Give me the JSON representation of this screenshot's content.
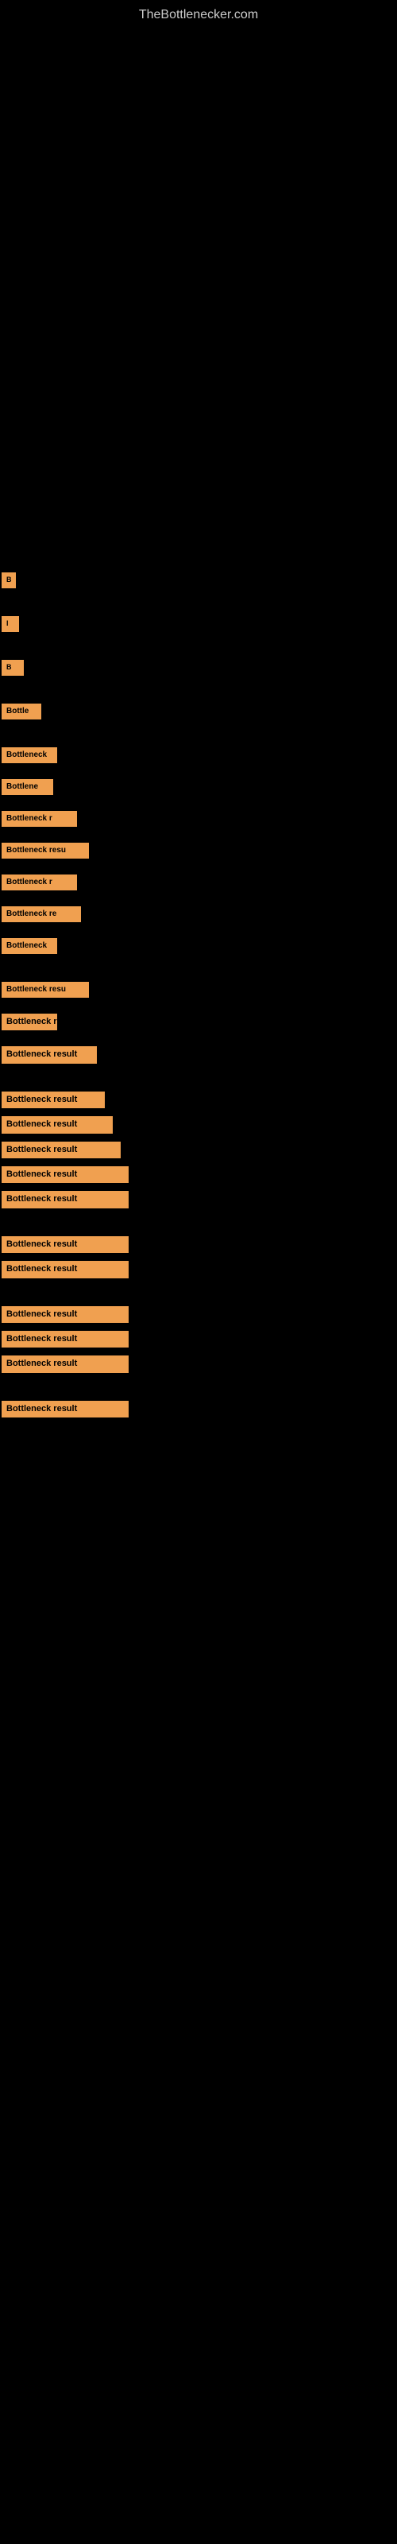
{
  "site": {
    "title": "TheBottlenecker.com"
  },
  "bottleneck_items": [
    {
      "id": 1,
      "label": "B",
      "size_class": "item-tiny",
      "spacing": "large"
    },
    {
      "id": 2,
      "label": "l",
      "size_class": "item-small1",
      "spacing": "large"
    },
    {
      "id": 3,
      "label": "B",
      "size_class": "item-small2",
      "spacing": "large"
    },
    {
      "id": 4,
      "label": "Bottle",
      "size_class": "item-med1",
      "spacing": "large"
    },
    {
      "id": 5,
      "label": "Bottleneck",
      "size_class": "item-med2",
      "spacing": "med"
    },
    {
      "id": 6,
      "label": "Bottlene",
      "size_class": "item-med3",
      "spacing": "med"
    },
    {
      "id": 7,
      "label": "Bottleneck r",
      "size_class": "item-med4",
      "spacing": "med"
    },
    {
      "id": 8,
      "label": "Bottleneck resu",
      "size_class": "item-med5",
      "spacing": "med"
    },
    {
      "id": 9,
      "label": "Bottleneck r",
      "size_class": "item-med4",
      "spacing": "med"
    },
    {
      "id": 10,
      "label": "Bottleneck re",
      "size_class": "item-med6",
      "spacing": "med"
    },
    {
      "id": 11,
      "label": "Bottleneck",
      "size_class": "item-med2",
      "spacing": "large"
    },
    {
      "id": 12,
      "label": "Bottleneck resu",
      "size_class": "item-med5",
      "spacing": "med"
    },
    {
      "id": 13,
      "label": "Bottleneck re",
      "size_class": "item-large1",
      "spacing": "med"
    },
    {
      "id": 14,
      "label": "Bottleneck result",
      "size_class": "item-large2",
      "spacing": "large"
    },
    {
      "id": 15,
      "label": "Bottleneck result",
      "size_class": "item-large3",
      "spacing": "small"
    },
    {
      "id": 16,
      "label": "Bottleneck result",
      "size_class": "item-large4",
      "spacing": "small"
    },
    {
      "id": 17,
      "label": "Bottleneck result",
      "size_class": "item-large5",
      "spacing": "small"
    },
    {
      "id": 18,
      "label": "Bottleneck result",
      "size_class": "item-full",
      "spacing": "small"
    },
    {
      "id": 19,
      "label": "Bottleneck result",
      "size_class": "item-full",
      "spacing": "large"
    },
    {
      "id": 20,
      "label": "Bottleneck result",
      "size_class": "item-full",
      "spacing": "small"
    },
    {
      "id": 21,
      "label": "Bottleneck result",
      "size_class": "item-full",
      "spacing": "large"
    },
    {
      "id": 22,
      "label": "Bottleneck result",
      "size_class": "item-full",
      "spacing": "small"
    },
    {
      "id": 23,
      "label": "Bottleneck result",
      "size_class": "item-full",
      "spacing": "small"
    },
    {
      "id": 24,
      "label": "Bottleneck result",
      "size_class": "item-full",
      "spacing": "large"
    },
    {
      "id": 25,
      "label": "Bottleneck result",
      "size_class": "item-full",
      "spacing": "small"
    }
  ]
}
